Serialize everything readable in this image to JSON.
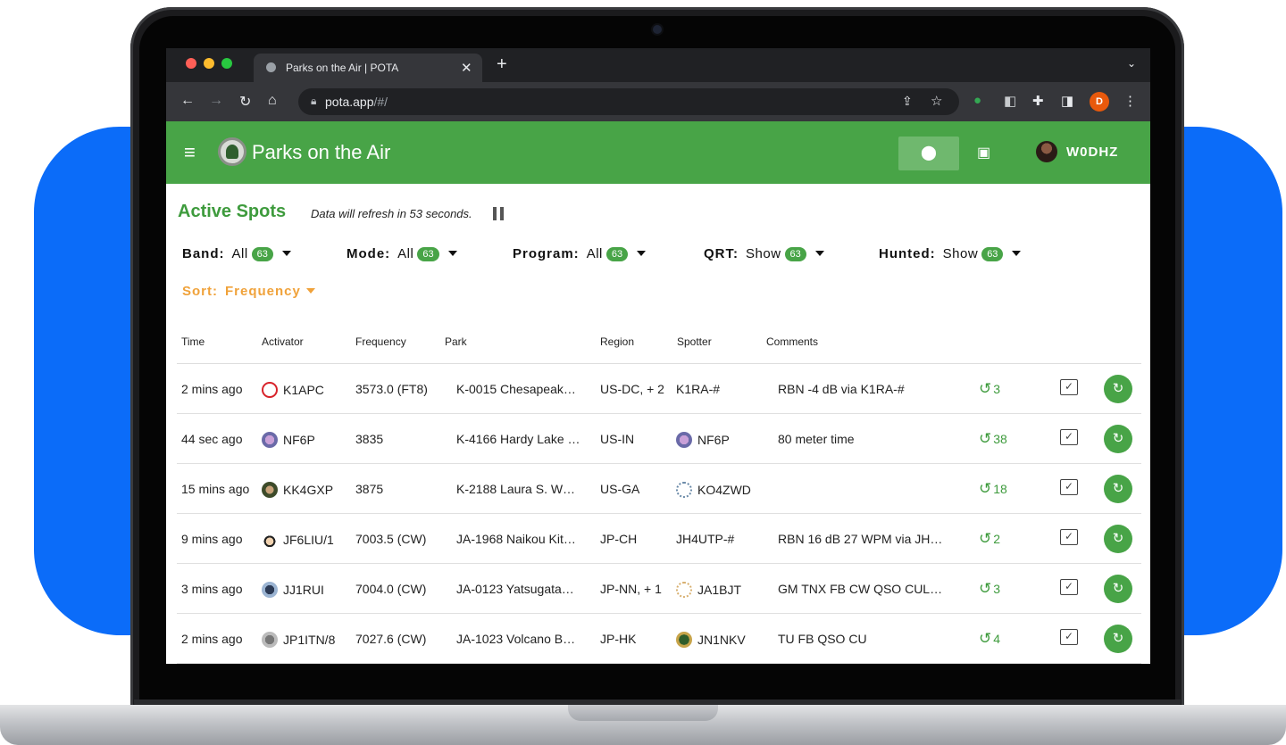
{
  "browser": {
    "tab_title": "Parks on the Air | POTA",
    "url_host": "pota.app",
    "url_path": "/#/",
    "profile_initial": "D"
  },
  "app": {
    "title": "Parks on the Air",
    "user_callsign": "W0DHZ"
  },
  "spots": {
    "title": "Active Spots",
    "refresh_text": "Data will refresh in 53 seconds."
  },
  "filters": {
    "band": {
      "label": "Band:",
      "value": "All",
      "count": "63"
    },
    "mode": {
      "label": "Mode:",
      "value": "All",
      "count": "63"
    },
    "program": {
      "label": "Program:",
      "value": "All",
      "count": "63"
    },
    "qrt": {
      "label": "QRT:",
      "value": "Show",
      "count": "63"
    },
    "hunted": {
      "label": "Hunted:",
      "value": "Show",
      "count": "63"
    },
    "sort": {
      "label": "Sort:",
      "value": "Frequency"
    }
  },
  "columns": [
    "Time",
    "Activator",
    "Frequency",
    "Park",
    "Region",
    "Spotter",
    "Comments"
  ],
  "rows": [
    {
      "time": "2 mins ago",
      "activator": "K1APC",
      "frequency": "3573.0 (FT8)",
      "park": "K-0015  Chesapeak…",
      "region": "US-DC, + 2",
      "spotter": "K1RA-#",
      "comments": "RBN -4 dB via K1RA-#",
      "hunts": "3"
    },
    {
      "time": "44 sec ago",
      "activator": "NF6P",
      "frequency": "3835",
      "park": "K-4166  Hardy Lake …",
      "region": "US-IN",
      "spotter": "NF6P",
      "comments": "80 meter time",
      "hunts": "38"
    },
    {
      "time": "15 mins ago",
      "activator": "KK4GXP",
      "frequency": "3875",
      "park": "K-2188  Laura S. W…",
      "region": "US-GA",
      "spotter": "KO4ZWD",
      "comments": "",
      "hunts": "18"
    },
    {
      "time": "9 mins ago",
      "activator": "JF6LIU/1",
      "frequency": "7003.5 (CW)",
      "park": "JA-1968  Naikou Kit…",
      "region": "JP-CH",
      "spotter": "JH4UTP-#",
      "comments": "RBN 16 dB 27 WPM via JH…",
      "hunts": "2"
    },
    {
      "time": "3 mins ago",
      "activator": "JJ1RUI",
      "frequency": "7004.0 (CW)",
      "park": "JA-0123  Yatsugata…",
      "region": "JP-NN, + 1",
      "spotter": "JA1BJT",
      "comments": "GM TNX FB CW QSO CUL…",
      "hunts": "3"
    },
    {
      "time": "2 mins ago",
      "activator": "JP1ITN/8",
      "frequency": "7027.6 (CW)",
      "park": "JA-1023  Volcano B…",
      "region": "JP-HK",
      "spotter": "JN1NKV",
      "comments": "TU FB QSO CU",
      "hunts": "4"
    }
  ],
  "colors": {
    "brand_green": "#48a447",
    "accent_orange": "#f0a23a",
    "backdrop_blue": "#0b6cf9"
  }
}
